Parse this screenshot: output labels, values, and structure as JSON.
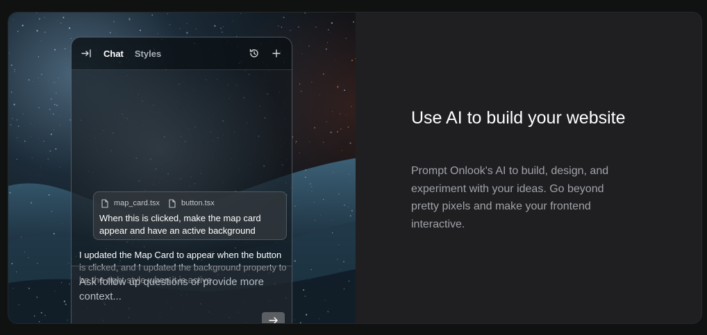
{
  "chat_panel": {
    "tabs": [
      {
        "label": "Chat",
        "active": true
      },
      {
        "label": "Styles",
        "active": false
      }
    ],
    "icons": {
      "collapse": "collapse-panel-icon",
      "history": "history-icon",
      "new_chat": "plus-icon",
      "file": "file-icon",
      "send": "arrow-right-icon"
    },
    "user_message": {
      "files": [
        "map_card.tsx",
        "button.tsx"
      ],
      "text": "When this is clicked, make the map card appear and have an active background"
    },
    "ai_message": {
      "text": "I updated the Map Card to appear when the button is clicked, and I updated the background property to be the right style when it is active."
    },
    "input": {
      "placeholder": "Ask follow up questions or provide more context..."
    }
  },
  "feature": {
    "headline": "Use AI to build your website",
    "description": "Prompt Onlook's AI to build, design, and experiment with your ideas. Go beyond pretty pixels and make your frontend interactive."
  },
  "colors": {
    "page_bg": "#101212",
    "card_bg": "#1f1f22",
    "headline": "#ffffff",
    "description": "#a0a3a8",
    "send_button": "#5b5f63"
  }
}
